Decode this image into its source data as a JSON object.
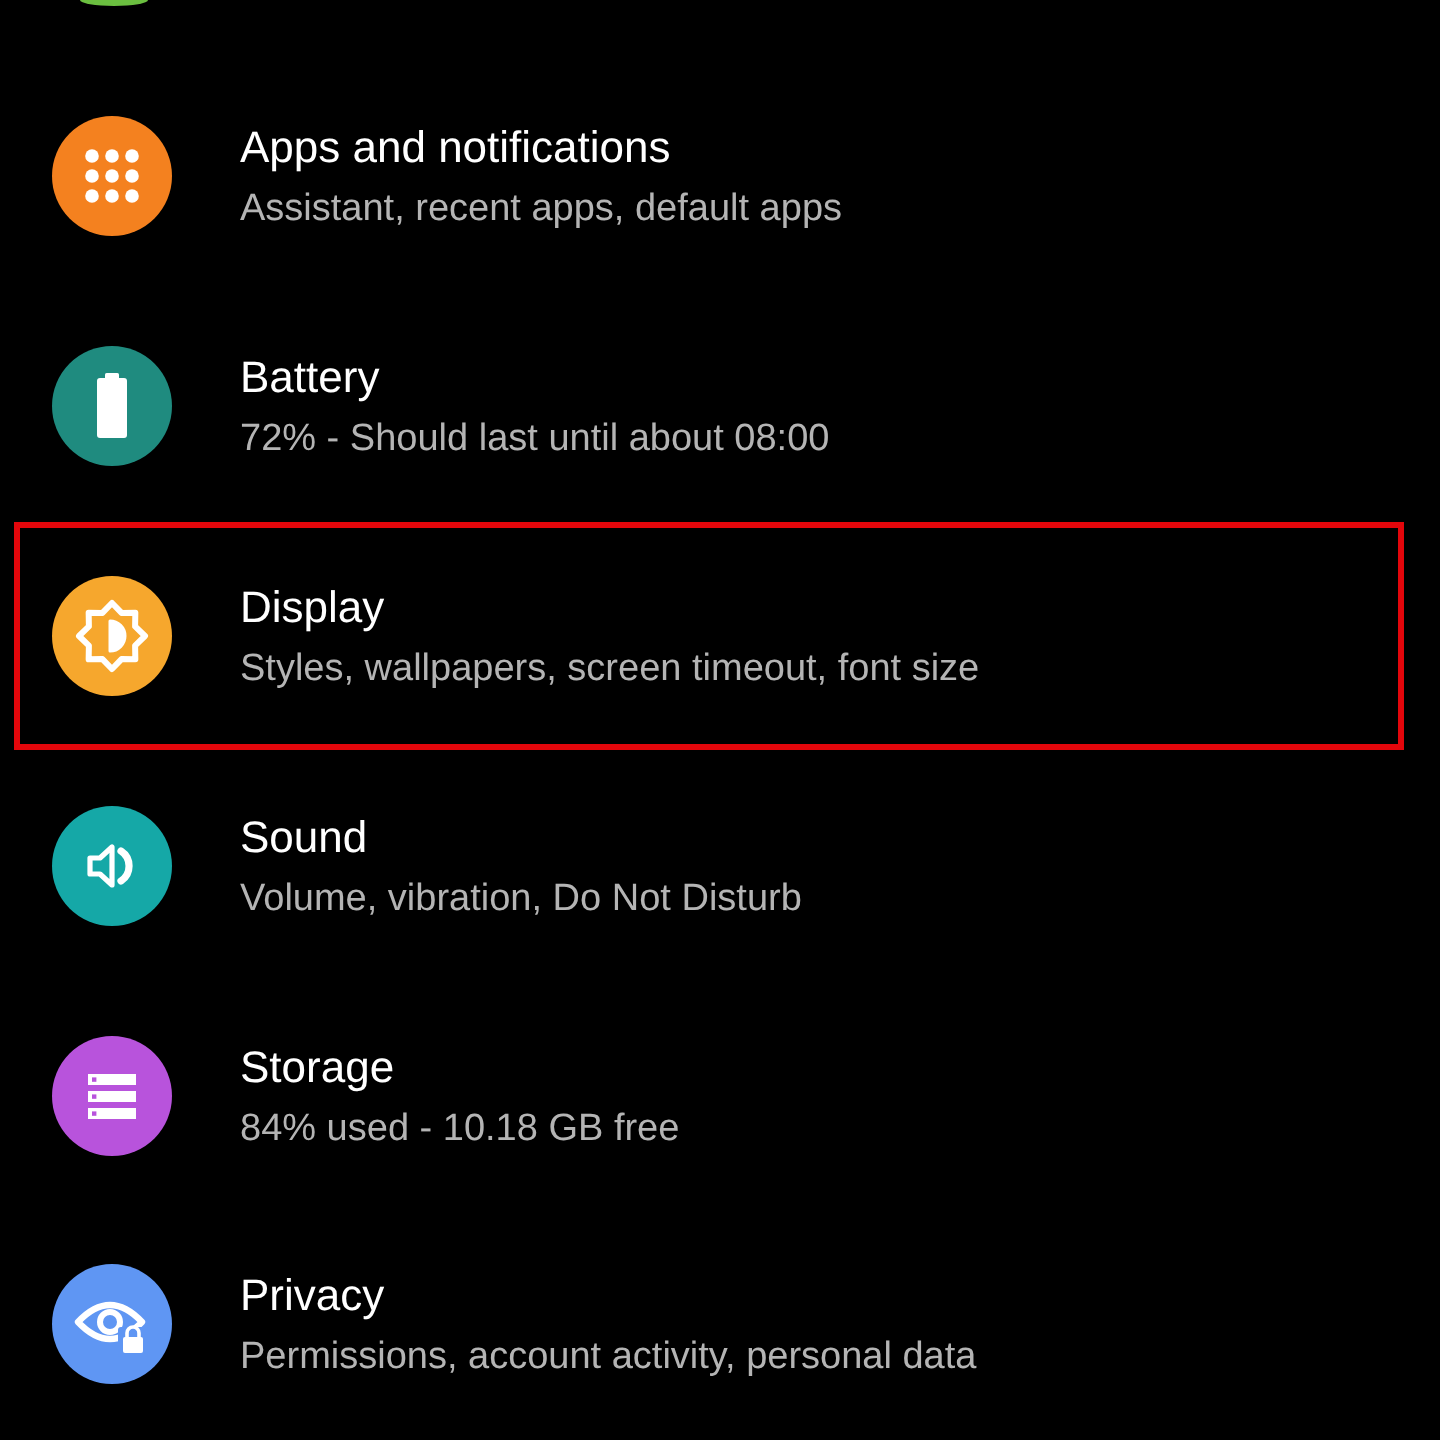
{
  "settings": {
    "items": [
      {
        "kind": "partial",
        "color": "#6bbf40"
      },
      {
        "kind": "apps",
        "color": "#f4811f",
        "title": "Apps and notifications",
        "subtitle": "Assistant, recent apps, default apps",
        "highlighted": false
      },
      {
        "kind": "battery",
        "color": "#1f8b7f",
        "title": "Battery",
        "subtitle": "72% - Should last until about 08:00",
        "highlighted": false
      },
      {
        "kind": "display",
        "color": "#f6a72d",
        "title": "Display",
        "subtitle": "Styles, wallpapers, screen timeout, font size",
        "highlighted": true
      },
      {
        "kind": "sound",
        "color": "#15a8a7",
        "title": "Sound",
        "subtitle": "Volume, vibration, Do Not Disturb",
        "highlighted": false
      },
      {
        "kind": "storage",
        "color": "#b853dc",
        "title": "Storage",
        "subtitle": "84% used - 10.18 GB free",
        "highlighted": false
      },
      {
        "kind": "privacy",
        "color": "#5f96f3",
        "title": "Privacy",
        "subtitle": "Permissions, account activity, personal data",
        "highlighted": false
      }
    ]
  }
}
